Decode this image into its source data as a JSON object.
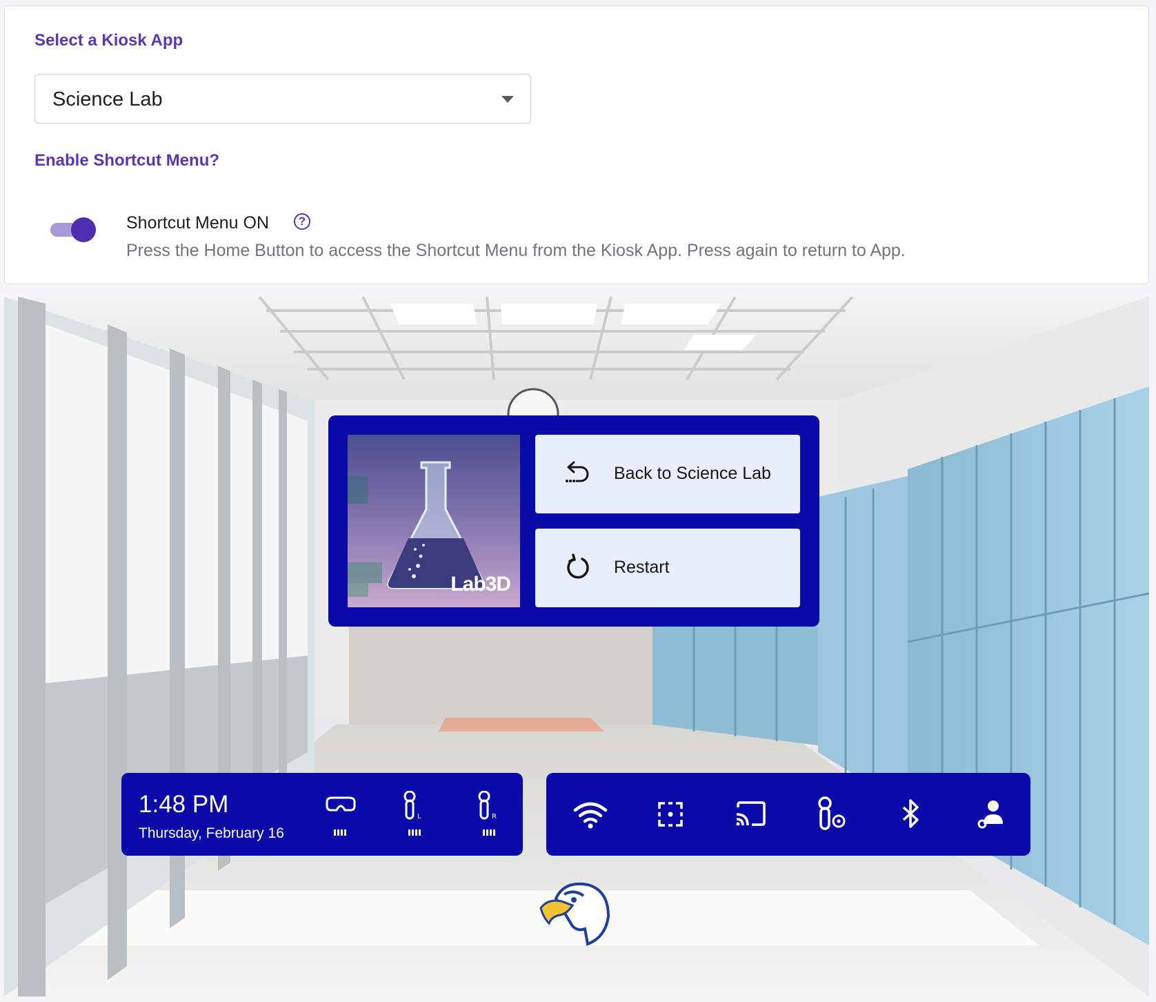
{
  "settings": {
    "kiosk_label": "Select a Kiosk App",
    "kiosk_selected": "Science Lab",
    "shortcut_label": "Enable Shortcut Menu?",
    "toggle_title": "Shortcut Menu ON",
    "toggle_state": true,
    "help_glyph": "?",
    "toggle_description": "Press the Home Button to access the Shortcut Menu from the Kiosk App. Press again to return to App."
  },
  "shortcut_menu": {
    "app_thumbnail_text": "Lab3D",
    "back_label": "Back to Science Lab",
    "restart_label": "Restart"
  },
  "status_bar": {
    "time": "1:48 PM",
    "date": "Thursday, February 16",
    "devices": [
      {
        "name": "headset-icon",
        "side": ""
      },
      {
        "name": "left-controller-icon",
        "side": "L"
      },
      {
        "name": "right-controller-icon",
        "side": "R"
      }
    ]
  },
  "quick_tools": [
    "wifi-icon",
    "guardian-boundary-icon",
    "cast-icon",
    "controller-settings-icon",
    "bluetooth-icon",
    "account-settings-icon"
  ],
  "colors": {
    "accent_purple": "#5b35b5",
    "panel_blue": "#0a0aa8",
    "button_bg": "#e9eefb"
  }
}
